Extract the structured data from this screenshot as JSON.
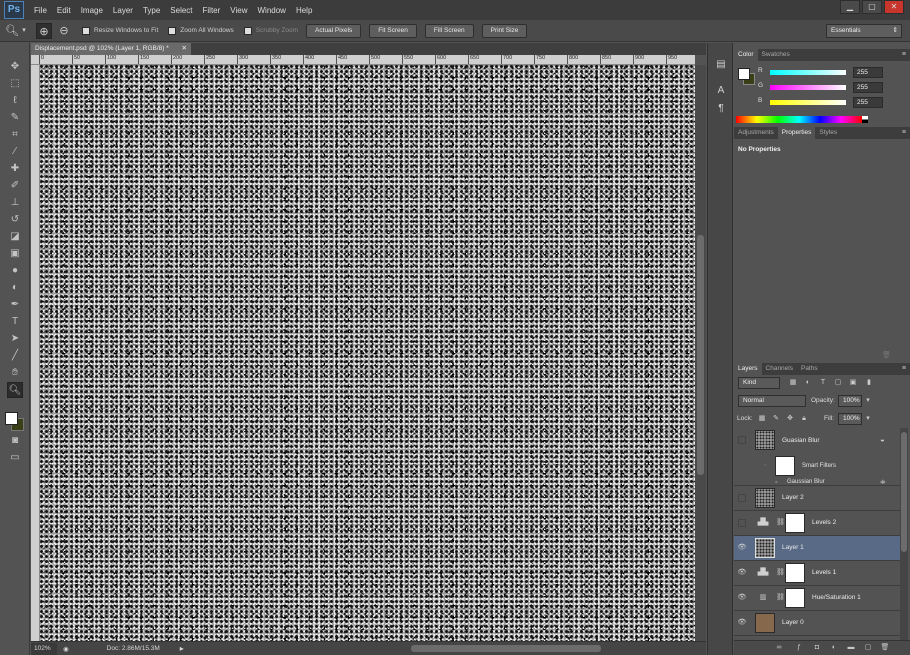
{
  "app": {
    "logo": "Ps"
  },
  "menu": [
    "File",
    "Edit",
    "Image",
    "Layer",
    "Type",
    "Select",
    "Filter",
    "View",
    "Window",
    "Help"
  ],
  "window_controls": {
    "minimize": "▁",
    "maximize": "▢",
    "close": "✕"
  },
  "options": {
    "tool_icon": "zoom-icon",
    "zoom_in_glyph": "⊕",
    "zoom_out_glyph": "⊖",
    "resize_windows": "Resize Windows to Fit",
    "zoom_all": "Zoom All Windows",
    "scrubby_zoom": "Scrubby Zoom",
    "actual_pixels": "Actual Pixels",
    "fit_screen": "Fit Screen",
    "fill_screen": "Fill Screen",
    "print_size": "Print Size",
    "workspace": "Essentials"
  },
  "document": {
    "tab_title": "Displacement.psd @ 102% (Layer 1, RGB/8) *",
    "zoom": "102%",
    "doc_info": "Doc: 2.86M/15.3M",
    "ruler_ticks": [
      "0",
      "50",
      "100",
      "150",
      "200",
      "250",
      "300",
      "350",
      "400",
      "450",
      "500",
      "550",
      "600",
      "650",
      "700",
      "750",
      "800",
      "850",
      "900",
      "950"
    ]
  },
  "colors": {
    "foreground": "#ffffff",
    "background": "#3a3f18",
    "layer_selected": "#586a85"
  },
  "color_panel": {
    "tabs": [
      "Color",
      "Swatches"
    ],
    "channels": [
      {
        "label": "R",
        "value": "255",
        "gradient": "linear-gradient(to right, #00ffff, #ffffff)"
      },
      {
        "label": "G",
        "value": "255",
        "gradient": "linear-gradient(to right, #ff00ff, #ffffff)"
      },
      {
        "label": "B",
        "value": "255",
        "gradient": "linear-gradient(to right, #ffff00, #ffffff)"
      }
    ]
  },
  "properties_panel": {
    "tabs": [
      "Adjustments",
      "Properties",
      "Styles"
    ],
    "message": "No Properties"
  },
  "layers_panel": {
    "tabs": [
      "Layers",
      "Channels",
      "Paths"
    ],
    "filter_kind": "Kind",
    "blend_mode": "Normal",
    "opacity_label": "Opacity:",
    "opacity": "100%",
    "lock_label": "Lock:",
    "fill_label": "Fill:",
    "fill": "100%",
    "smart_filters_label": "Smart Filters",
    "smart_filter_item": "Gaussian Blur",
    "layers": [
      {
        "name": "Guasian Blur",
        "visible": false
      },
      {
        "name": "Layer 2",
        "visible": false
      },
      {
        "name": "Levels 2",
        "visible": false
      },
      {
        "name": "Layer 1",
        "visible": true,
        "selected": true
      },
      {
        "name": "Levels 1",
        "visible": true
      },
      {
        "name": "Hue/Saturation 1",
        "visible": true
      },
      {
        "name": "Layer 0",
        "visible": true
      }
    ]
  }
}
